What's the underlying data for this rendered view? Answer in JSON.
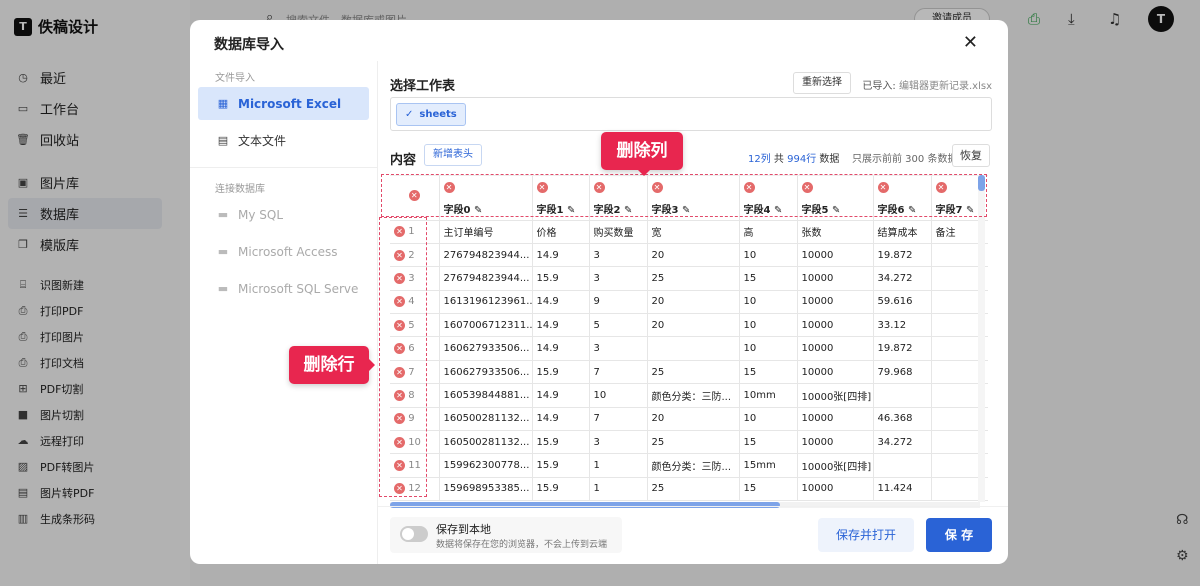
{
  "app": {
    "logo_text": "佚稿设计",
    "search_placeholder": "搜索文件，数据库或图片",
    "invite_label": "邀请成员",
    "avatar_letter": "T"
  },
  "nav": {
    "main": [
      {
        "label": "最近",
        "icon": "clock-icon"
      },
      {
        "label": "工作台",
        "icon": "workspace-icon"
      },
      {
        "label": "回收站",
        "icon": "trash-icon"
      }
    ],
    "libs": [
      {
        "label": "图片库",
        "icon": "image-icon"
      },
      {
        "label": "数据库",
        "icon": "database-icon",
        "active": true
      },
      {
        "label": "模版库",
        "icon": "template-icon"
      }
    ],
    "tools": [
      {
        "label": "识图新建"
      },
      {
        "label": "打印PDF"
      },
      {
        "label": "打印图片"
      },
      {
        "label": "打印文档"
      },
      {
        "label": "PDF切割"
      },
      {
        "label": "图片切割"
      },
      {
        "label": "远程打印"
      },
      {
        "label": "PDF转图片"
      },
      {
        "label": "图片转PDF"
      },
      {
        "label": "生成条形码"
      }
    ]
  },
  "modal": {
    "title": "数据库导入",
    "close": "✕",
    "side": {
      "file_header": "文件导入",
      "file_items": [
        {
          "label": "Microsoft Excel",
          "active": true
        },
        {
          "label": "文本文件"
        }
      ],
      "db_header": "连接数据库",
      "db_items": [
        {
          "label": "My SQL"
        },
        {
          "label": "Microsoft Access"
        },
        {
          "label": "Microsoft SQL Serve"
        }
      ]
    },
    "select_sheet_title": "选择工作表",
    "reselect_label": "重新选择",
    "imported_prefix": "已导入:",
    "imported_file": "编辑器更新记录.xlsx",
    "sheet_tag": "sheets",
    "content_title": "内容",
    "add_header_label": "新增表头",
    "stats": {
      "cols": "12列",
      "mid": "共",
      "rows": "994行",
      "suffix": "数据"
    },
    "preview_note": "只展示前前 300 条数据",
    "restore_label": "恢复",
    "columns": [
      "字段0",
      "字段1",
      "字段2",
      "字段3",
      "字段4",
      "字段5",
      "字段6",
      "字段7"
    ],
    "rows": [
      [
        "1",
        "主订单编号",
        "价格",
        "购买数量",
        "宽",
        "高",
        "张数",
        "结算成本",
        "备注"
      ],
      [
        "2",
        "276794823944...",
        "14.9",
        "3",
        "20",
        "10",
        "10000",
        "19.872",
        ""
      ],
      [
        "3",
        "276794823944...",
        "15.9",
        "3",
        "25",
        "15",
        "10000",
        "34.272",
        ""
      ],
      [
        "4",
        "1613196123961...",
        "14.9",
        "9",
        "20",
        "10",
        "10000",
        "59.616",
        ""
      ],
      [
        "5",
        "1607006712311...",
        "14.9",
        "5",
        "20",
        "10",
        "10000",
        "33.12",
        ""
      ],
      [
        "6",
        "160627933506...",
        "14.9",
        "3",
        "",
        "10",
        "10000",
        "19.872",
        ""
      ],
      [
        "7",
        "160627933506...",
        "15.9",
        "7",
        "25",
        "15",
        "10000",
        "79.968",
        ""
      ],
      [
        "8",
        "160539844881...",
        "14.9",
        "10",
        "颜色分类：三防...",
        "10mm",
        "10000张[四排]",
        "",
        ""
      ],
      [
        "9",
        "160500281132...",
        "14.9",
        "7",
        "20",
        "10",
        "10000",
        "46.368",
        ""
      ],
      [
        "10",
        "160500281132...",
        "15.9",
        "3",
        "25",
        "15",
        "10000",
        "34.272",
        ""
      ],
      [
        "11",
        "159962300778...",
        "15.9",
        "1",
        "颜色分类：三防...",
        "15mm",
        "10000张[四排]",
        "",
        ""
      ],
      [
        "12",
        "159698953385...",
        "15.9",
        "1",
        "25",
        "15",
        "10000",
        "11.424",
        ""
      ]
    ],
    "footer": {
      "save_local_label": "保存到本地",
      "save_local_desc": "数据将保存在您的浏览器，不会上传到云端",
      "save_open_label": "保存并打开",
      "save_label": "保 存"
    }
  },
  "callouts": {
    "delete_col": "删除列",
    "delete_row": "删除行"
  }
}
